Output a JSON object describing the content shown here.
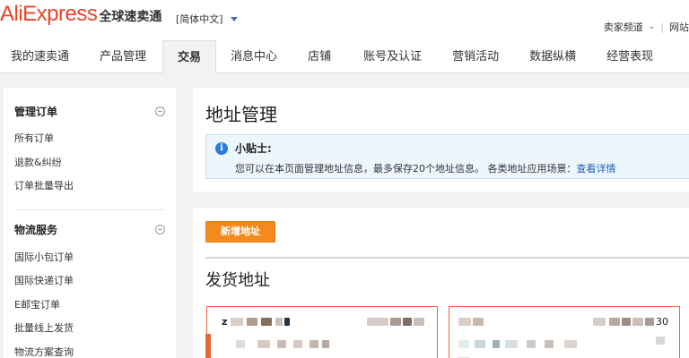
{
  "header": {
    "logo_en": "AliExpress",
    "logo_cn": "全球速卖通",
    "language": "[简体中文]",
    "seller_channel": "卖家频道",
    "site_link": "网站"
  },
  "nav": {
    "items": [
      "我的速卖通",
      "产品管理",
      "交易",
      "消息中心",
      "店铺",
      "账号及认证",
      "营销活动",
      "数据纵横",
      "经营表现"
    ],
    "active": "交易"
  },
  "sidebar": {
    "groups": [
      {
        "title": "管理订单",
        "links": [
          "所有订单",
          "退款&纠纷",
          "订单批量导出"
        ]
      },
      {
        "title": "物流服务",
        "links": [
          "国际小包订单",
          "国际快递订单",
          "E邮宝订单",
          "批量线上发货",
          "物流方案查询"
        ]
      }
    ]
  },
  "main": {
    "page_title": "地址管理",
    "tip": {
      "title": "小贴士:",
      "text": "您可以在本页面管理地址信息，最多保存20个地址信息。 各类地址应用场景：",
      "link": "查看详情"
    },
    "add_button": "新增地址",
    "section_title": "发货地址",
    "card1_prefix": "z",
    "card2_suffix": "30"
  },
  "colors": {
    "brand": "#e8442a",
    "accent_orange": "#f28a1f",
    "link_blue": "#1a5db4"
  }
}
